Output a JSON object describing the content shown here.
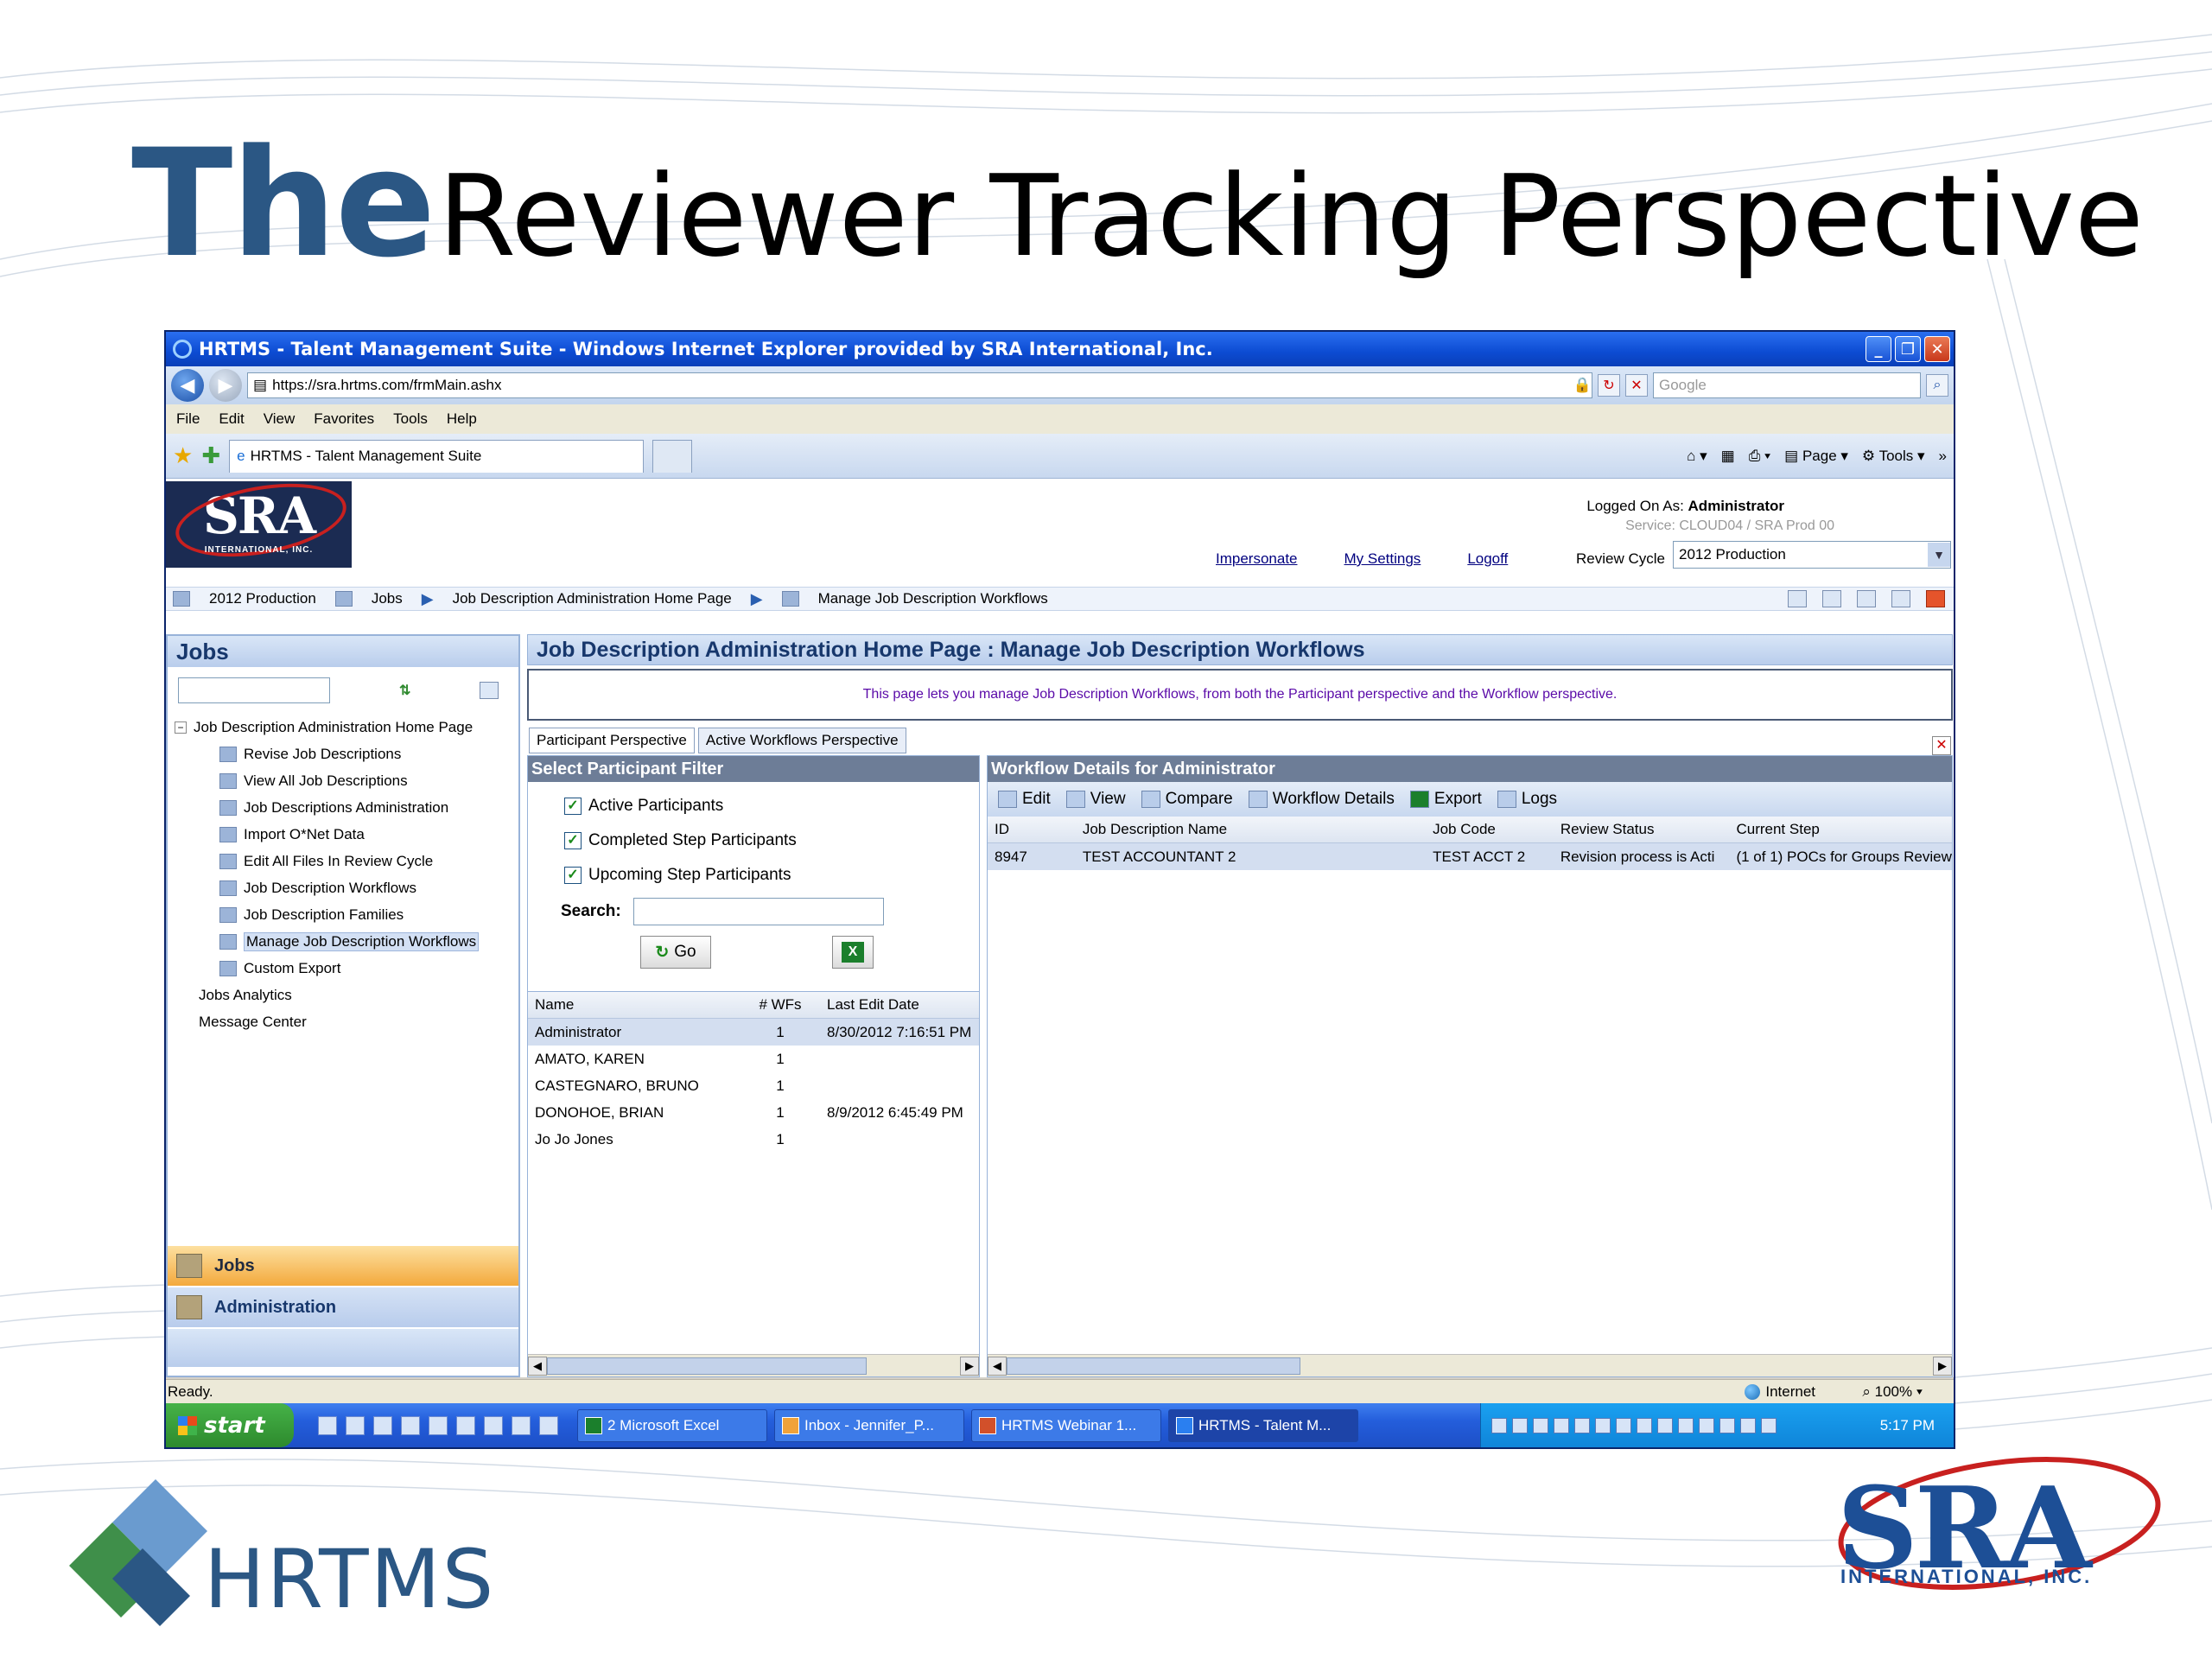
{
  "slide": {
    "title_emphasis": "The",
    "title_rest": "Reviewer Tracking Perspective"
  },
  "browser": {
    "title": "HRTMS - Talent Management Suite - Windows Internet Explorer provided by SRA International, Inc.",
    "url": "https://sra.hrtms.com/frmMain.ashx",
    "search_placeholder": "Google",
    "menu": [
      "File",
      "Edit",
      "View",
      "Favorites",
      "Tools",
      "Help"
    ],
    "tab_label": "HRTMS - Talent Management Suite",
    "cmd": {
      "page": "Page",
      "tools": "Tools"
    }
  },
  "app": {
    "logo": "SRA",
    "logo_sub": "INTERNATIONAL, INC.",
    "logged_label": "Logged On As:",
    "logged_user": "Administrator",
    "service": "Service: CLOUD04 / SRA Prod 00",
    "links": {
      "impersonate": "Impersonate",
      "settings": "My Settings",
      "logoff": "Logoff"
    },
    "review_cycle_label": "Review Cycle",
    "review_cycle_value": "2012 Production",
    "breadcrumb": [
      "2012 Production",
      "Jobs",
      "Job Description Administration Home Page",
      "Manage Job Description Workflows"
    ]
  },
  "left": {
    "heading": "Jobs",
    "tree_root": "Job Description Administration Home Page",
    "tree_children": [
      "Revise Job Descriptions",
      "View All Job Descriptions",
      "Job Descriptions Administration",
      "Import O*Net Data",
      "Edit All Files In Review Cycle",
      "Job Description Workflows",
      "Job Description Families",
      "Manage Job Description Workflows",
      "Custom Export"
    ],
    "tree_other": [
      "Jobs Analytics",
      "Message Center"
    ],
    "nav_jobs": "Jobs",
    "nav_admin": "Administration"
  },
  "main": {
    "heading": "Job Description Administration Home Page : Manage Job Description Workflows",
    "info": "This page lets you manage Job Description Workflows, from both the Participant perspective and the Workflow perspective.",
    "tabs": [
      "Participant Perspective",
      "Active Workflows Perspective"
    ],
    "filter": {
      "heading": "Select Participant Filter",
      "checks": [
        "Active Participants",
        "Completed Step Participants",
        "Upcoming Step Participants"
      ],
      "search_label": "Search:",
      "go": "Go"
    },
    "participants": {
      "columns": [
        "Name",
        "# WFs",
        "Last Edit Date"
      ],
      "rows": [
        [
          "Administrator",
          "1",
          "8/30/2012 7:16:51 PM"
        ],
        [
          "AMATO, KAREN",
          "1",
          ""
        ],
        [
          "CASTEGNARO, BRUNO",
          "1",
          ""
        ],
        [
          "DONOHOE, BRIAN",
          "1",
          "8/9/2012 6:45:49 PM"
        ],
        [
          "Jo Jo Jones",
          "1",
          ""
        ]
      ]
    },
    "workflow": {
      "heading": "Workflow Details for Administrator",
      "tools": [
        "Edit",
        "View",
        "Compare",
        "Workflow Details",
        "Export",
        "Logs"
      ],
      "columns": [
        "ID",
        "Job Description Name",
        "Job Code",
        "Review Status",
        "Current Step"
      ],
      "rows": [
        [
          "8947",
          "TEST ACCOUNTANT 2",
          "TEST ACCT 2",
          "Revision process is Acti",
          "(1 of 1) POCs for Groups Review"
        ]
      ]
    }
  },
  "status": {
    "text": "Ready.",
    "zone": "Internet",
    "zoom": "100%"
  },
  "taskbar": {
    "start": "start",
    "buttons": [
      "2 Microsoft Excel",
      "Inbox - Jennifer_P...",
      "HRTMS Webinar 1...",
      "HRTMS - Talent M..."
    ],
    "clock": "5:17 PM"
  },
  "footer": {
    "hrtms": "HRTMS",
    "sra": "SRA",
    "sra_sub": "INTERNATIONAL, INC."
  }
}
